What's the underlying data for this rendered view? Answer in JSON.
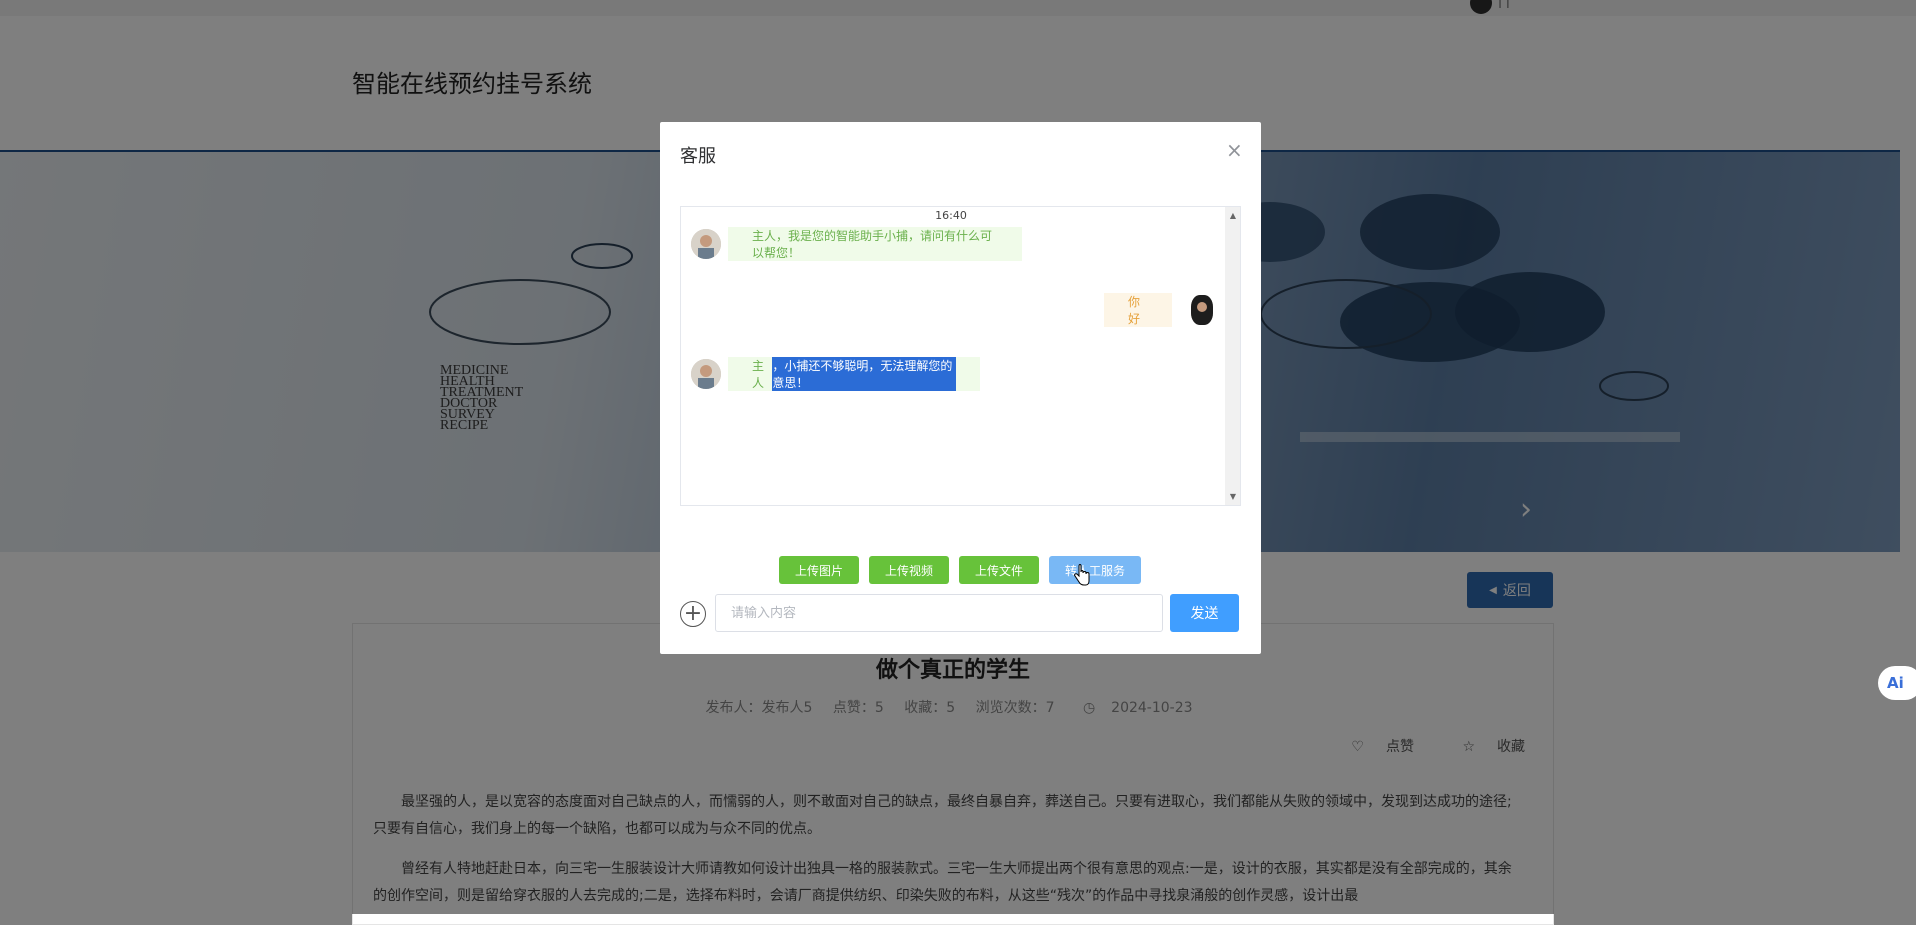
{
  "header": {
    "title": "智能在线预约挂号系统",
    "user_name": "| |"
  },
  "banner": {
    "words": [
      "MEDICINE",
      "HEALTH",
      "TREATMENT",
      "DOCTOR",
      "SURVEY",
      "RECIPE"
    ]
  },
  "article": {
    "back_label": "返回",
    "title": "做个真正的学生",
    "meta": {
      "publisher": "发布人：发布人5",
      "likes": "点赞：5",
      "favorites": "收藏：5",
      "views": "浏览次数：7",
      "date": "2024-10-23"
    },
    "like_label": "点赞",
    "favorite_label": "收藏",
    "paragraphs": [
      "最坚强的人，是以宽容的态度面对自己缺点的人，而懦弱的人，则不敢面对自己的缺点，最终自暴自弃，葬送自己。只要有进取心，我们都能从失败的领域中，发现到达成功的途径;只要有自信心，我们身上的每一个缺陷，也都可以成为与众不同的优点。",
      "曾经有人特地赶赴日本，向三宅一生服装设计大师请教如何设计出独具一格的服装款式。三宅一生大师提出两个很有意思的观点:一是，设计的衣服，其实都是没有全部完成的，其余的创作空间，则是留给穿衣服的人去完成的;二是，选择布料时，会请厂商提供纺织、印染失败的布料，从这些“残次”的作品中寻找泉涌般的创作灵感，设计出最"
    ]
  },
  "dialog": {
    "title": "客服",
    "close": "×",
    "time": "16:40",
    "messages": [
      {
        "side": "left",
        "text": "主人，我是您的智能助手小捕，请问有什么可以帮您！"
      },
      {
        "side": "right",
        "text": "你好"
      },
      {
        "side": "left",
        "prefix": "主人",
        "highlight": "，小捕还不够聪明，无法理解您的意思！"
      }
    ],
    "buttons": {
      "image": "上传图片",
      "video": "上传视频",
      "file": "上传文件",
      "human": "转人工服务"
    },
    "input_placeholder": "请输入内容",
    "send": "发送"
  },
  "ai_badge": "Ai"
}
